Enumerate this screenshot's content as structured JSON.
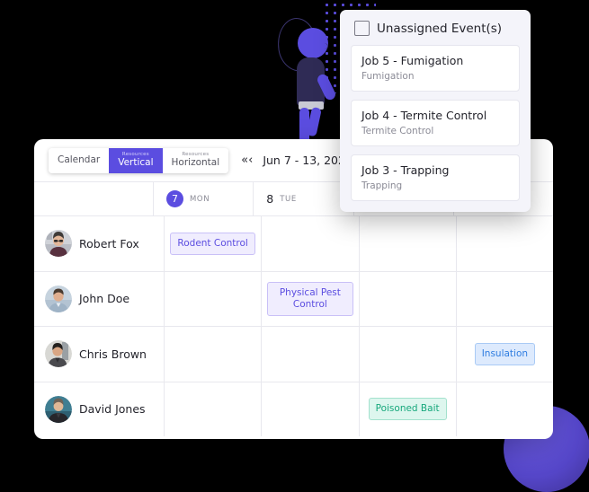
{
  "colors": {
    "accent": "#5b4de0",
    "chip_purple_bg": "#f0edfe",
    "chip_purple_text": "#5b4de0",
    "chip_blue_bg": "#ddeafd",
    "chip_blue_text": "#2f7de1",
    "chip_teal_bg": "#ddf6ee",
    "chip_teal_text": "#17a87c",
    "popup_bg": "#f4f4fa",
    "page_bg": "#000000"
  },
  "toolbar": {
    "views": [
      {
        "sup": "",
        "label": "Calendar",
        "active": false,
        "name": "view-calendar"
      },
      {
        "sup": "Resources",
        "label": "Vertical",
        "active": true,
        "name": "view-resources-vertical"
      },
      {
        "sup": "Resources",
        "label": "Horizontal",
        "active": false,
        "name": "view-resources-horizontal"
      }
    ],
    "prev_all_icon": "chevron-double-left-icon",
    "prev_icon": "chevron-left-icon",
    "date_range": "Jun 7 - 13, 2021",
    "calendar_icon": "calendar-icon"
  },
  "grid": {
    "resource_column_header": "",
    "days": [
      {
        "num": "7",
        "dow": "MON",
        "today": true
      },
      {
        "num": "8",
        "dow": "TUE",
        "today": false
      },
      {
        "num": "",
        "dow": "",
        "today": false
      },
      {
        "num": "",
        "dow": "",
        "today": false
      }
    ],
    "rows": [
      {
        "name": "Robert Fox",
        "avatar": "avatar-robert-fox",
        "events": [
          {
            "label": "Rodent Control",
            "color": "purple"
          },
          null,
          null,
          null
        ]
      },
      {
        "name": "John Doe",
        "avatar": "avatar-john-doe",
        "events": [
          null,
          {
            "label": "Physical Pest Control",
            "color": "purple"
          },
          null,
          null
        ]
      },
      {
        "name": "Chris Brown",
        "avatar": "avatar-chris-brown",
        "events": [
          null,
          null,
          null,
          {
            "label": "Insulation",
            "color": "blue"
          }
        ]
      },
      {
        "name": "David Jones",
        "avatar": "avatar-david-jones",
        "events": [
          null,
          null,
          {
            "label": "Poisoned Bait",
            "color": "teal"
          },
          null
        ]
      }
    ]
  },
  "popup": {
    "checkbox_icon": "checkbox-unchecked-icon",
    "title": "Unassigned  Event(s)",
    "jobs": [
      {
        "title": "Job 5 - Fumigation",
        "subtitle": "Fumigation"
      },
      {
        "title": "Job 4 - Termite Control",
        "subtitle": "Termite Control"
      },
      {
        "title": "Job 3 - Trapping",
        "subtitle": "Trapping"
      }
    ]
  }
}
